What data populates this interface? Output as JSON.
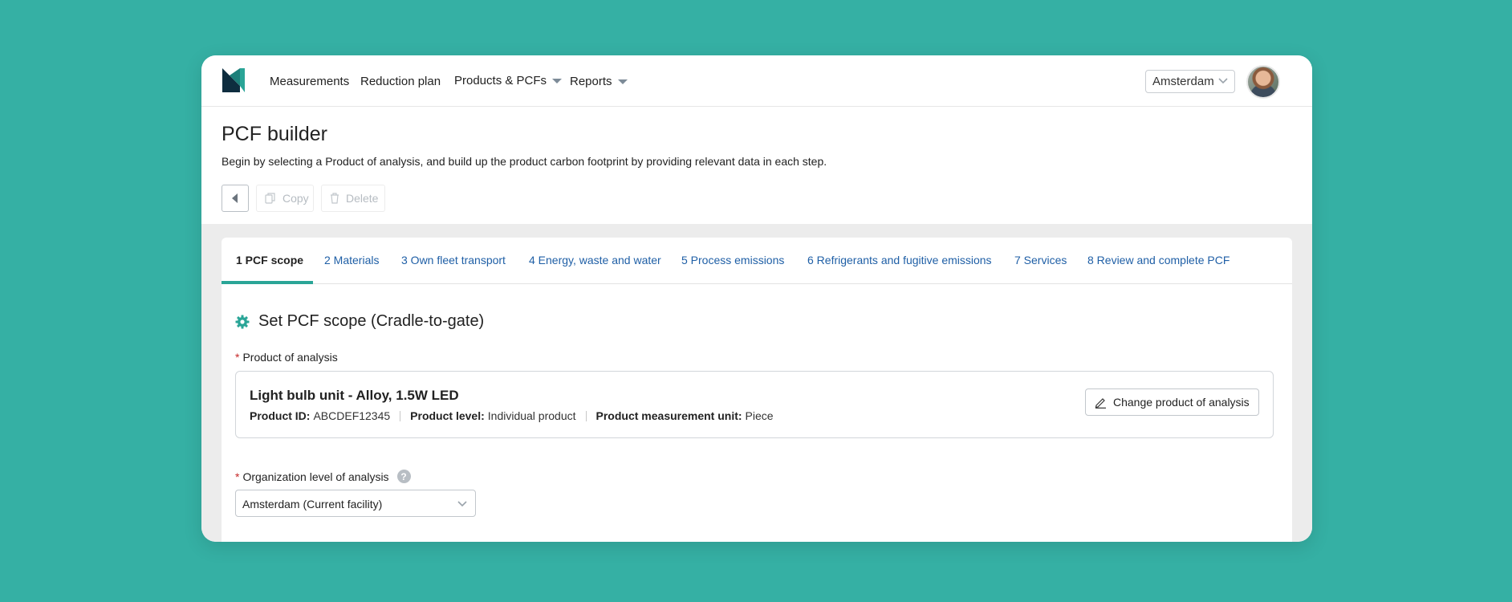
{
  "colors": {
    "background": "#35b0a4",
    "accent": "#2aa597",
    "link": "#1f5fa6",
    "required": "#c62828"
  },
  "nav": {
    "logo_icon": "brand-logo-icon",
    "items": [
      {
        "label": "Measurements"
      },
      {
        "label": "Reduction plan"
      },
      {
        "label": "Products & PCFs",
        "has_dropdown": true
      },
      {
        "label": "Reports",
        "has_dropdown": true
      }
    ],
    "facility_select": "Amsterdam",
    "avatar_icon": "user-avatar"
  },
  "header": {
    "title": "PCF builder",
    "description": "Begin by selecting a Product of analysis, and build up the product carbon footprint by providing relevant data in each step.",
    "back_icon": "caret-left-icon",
    "copy_label": "Copy",
    "delete_label": "Delete"
  },
  "tabs": [
    {
      "label": "1 PCF scope",
      "active": true
    },
    {
      "label": "2 Materials"
    },
    {
      "label": "3 Own fleet transport"
    },
    {
      "label": "4 Energy, waste and water"
    },
    {
      "label": "5 Process emissions"
    },
    {
      "label": "6 Refrigerants and fugitive emissions"
    },
    {
      "label": "7 Services"
    },
    {
      "label": "8 Review and complete PCF"
    }
  ],
  "scope": {
    "section_icon": "gear-icon",
    "title": "Set PCF scope (Cradle-to-gate)",
    "product_label": "Product of analysis",
    "required_mark": "*",
    "product": {
      "name": "Light bulb unit - Alloy, 1.5W LED",
      "id_label": "Product ID:",
      "id_value": "ABCDEF12345",
      "level_label": "Product level:",
      "level_value": "Individual product",
      "unit_label": "Product measurement unit:",
      "unit_value": "Piece"
    },
    "change_button": "Change product of analysis",
    "org_label": "Organization level of analysis",
    "help_glyph": "?",
    "org_value": "Amsterdam (Current facility)"
  }
}
